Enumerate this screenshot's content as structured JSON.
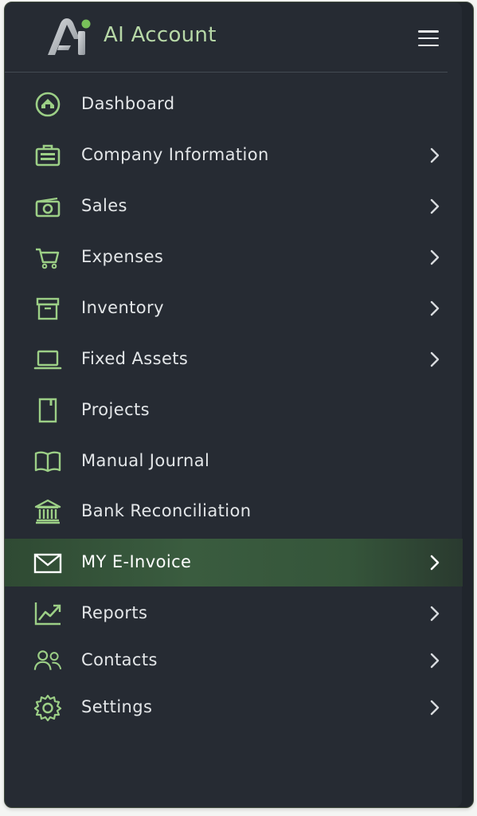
{
  "app": {
    "title": "AI Account",
    "logo_icon": "ai-logo-icon",
    "menu_icon": "hamburger-icon"
  },
  "colors": {
    "panel_bg": "#262b33",
    "accent_green": "#9ccf86",
    "active_bg": "#3a5c3f",
    "text": "#e3e6e8"
  },
  "menu": {
    "items": [
      {
        "label": "Dashboard",
        "icon": "home-icon",
        "has_submenu": false,
        "active": false
      },
      {
        "label": "Company Information",
        "icon": "briefcase-icon",
        "has_submenu": true,
        "active": false
      },
      {
        "label": "Sales",
        "icon": "cash-icon",
        "has_submenu": true,
        "active": false
      },
      {
        "label": "Expenses",
        "icon": "cart-icon",
        "has_submenu": true,
        "active": false
      },
      {
        "label": "Inventory",
        "icon": "archive-box-icon",
        "has_submenu": true,
        "active": false
      },
      {
        "label": "Fixed Assets",
        "icon": "laptop-icon",
        "has_submenu": true,
        "active": false
      },
      {
        "label": "Projects",
        "icon": "notebook-icon",
        "has_submenu": false,
        "active": false
      },
      {
        "label": "Manual Journal",
        "icon": "book-open-icon",
        "has_submenu": false,
        "active": false
      },
      {
        "label": "Bank Reconciliation",
        "icon": "bank-icon",
        "has_submenu": false,
        "active": false
      },
      {
        "label": "MY E-Invoice",
        "icon": "envelope-icon",
        "has_submenu": true,
        "active": true
      },
      {
        "label": "Reports",
        "icon": "trend-chart-icon",
        "has_submenu": true,
        "active": false
      },
      {
        "label": "Contacts",
        "icon": "users-icon",
        "has_submenu": true,
        "active": false
      },
      {
        "label": "Settings",
        "icon": "gear-icon",
        "has_submenu": true,
        "active": false
      }
    ]
  }
}
